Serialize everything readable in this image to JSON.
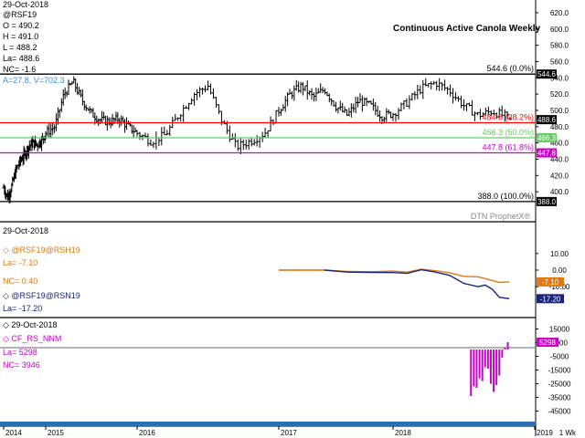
{
  "title": "Continuous Active Canola Weekly",
  "watermark": "DTN ProphetX®",
  "price_panel": {
    "date": "29-Oct-2018",
    "symbol": "@RSF19",
    "ohlc": [
      "O = 490.2",
      "H = 491.0",
      "L = 488.2",
      "La= 488.6",
      "NC= -1.6"
    ],
    "cursor_readout": "A=27.8, V=702.3",
    "y_ticks": [
      400,
      420,
      440,
      460,
      480,
      500,
      520,
      540,
      560,
      580,
      600,
      620
    ],
    "last_price_label": "488.6",
    "fib_levels": [
      {
        "price": 544.6,
        "label": "544.6 (0.0%)",
        "line_color": "#000000",
        "text_color": "#000000"
      },
      {
        "price": 484.8,
        "label": "484.8 (38.2%)",
        "line_color": "#ff0000",
        "text_color": "#ff0000"
      },
      {
        "price": 466.3,
        "label": "466.3 (50.0%)",
        "line_color": "#66cc66",
        "text_color": "#66cc66"
      },
      {
        "price": 447.8,
        "label": "447.8 (61.8%)",
        "line_color": "#cc00cc",
        "text_color": "#cc00cc"
      },
      {
        "price": 388.0,
        "label": "388.0 (100.0%)",
        "line_color": "#000000",
        "text_color": "#000000"
      }
    ],
    "axis_boxes": [
      {
        "price": 544.6,
        "text": "544.6",
        "fill": "#000000"
      },
      {
        "price": 488.6,
        "text": "488.6",
        "fill": "#000000"
      },
      {
        "price": 466.3,
        "text": "466.3",
        "fill": "#66cc66"
      },
      {
        "price": 447.8,
        "text": "447.8",
        "fill": "#cc00cc"
      },
      {
        "price": 388.0,
        "text": "388.0",
        "fill": "#000000"
      }
    ]
  },
  "spread_panel": {
    "date": "29-Oct-2018",
    "legend": [
      {
        "symbol": "@RSF19@RSH19",
        "color": "#e07a10"
      },
      {
        "symbol": "@RSF19@RSN19",
        "color": "#1a237e"
      }
    ],
    "readouts": [
      {
        "text": "La= -7.10",
        "color": "#e07a10"
      },
      {
        "text": "NC= 0.40",
        "color": "#e07a10"
      },
      {
        "text": "La= -17.20",
        "color": "#1a237e"
      }
    ],
    "y_ticks": [
      10.0,
      0.0,
      -10.0
    ],
    "axis_boxes": [
      {
        "value": -7.1,
        "text": "-7.10",
        "fill": "#e07a10"
      },
      {
        "value": -17.2,
        "text": "-17.20",
        "fill": "#1a237e"
      }
    ]
  },
  "cot_panel": {
    "date": "29-Oct-2018",
    "symbol": "CF_RS_NNM",
    "color": "#cc00cc",
    "readouts": [
      "La= 5298",
      "NC= 3946"
    ],
    "y_ticks": [
      15000,
      5000,
      -5000,
      -15000,
      -25000,
      -35000,
      -45000
    ],
    "axis_box": {
      "value": 5298,
      "text": "5298",
      "fill": "#cc00cc"
    }
  },
  "x_axis": {
    "labels": [
      "2014",
      "2015",
      "2016",
      "2017",
      "2018",
      "2019"
    ],
    "label_dates": [
      2014.0,
      2015.0,
      2016.0,
      2017.0,
      2018.0,
      2019.0
    ],
    "unit_label": "1 Wk"
  },
  "chart_data": [
    {
      "type": "candlestick",
      "title": "Continuous Active Canola Weekly",
      "series_name": "@RSF19",
      "ylim": [
        380,
        630
      ],
      "xlim": [
        2014.0,
        2019.3
      ],
      "weekly_close_estimates": [
        [
          2014.0,
          405
        ],
        [
          2014.1,
          393
        ],
        [
          2014.2,
          408
        ],
        [
          2014.3,
          428
        ],
        [
          2014.4,
          438
        ],
        [
          2014.5,
          446
        ],
        [
          2014.6,
          456
        ],
        [
          2014.7,
          460
        ],
        [
          2014.8,
          458
        ],
        [
          2014.9,
          463
        ],
        [
          2015.0,
          472
        ],
        [
          2015.1,
          480
        ],
        [
          2015.2,
          520
        ],
        [
          2015.3,
          535
        ],
        [
          2015.4,
          512
        ],
        [
          2015.5,
          496
        ],
        [
          2015.6,
          488
        ],
        [
          2015.7,
          486
        ],
        [
          2015.8,
          490
        ],
        [
          2015.9,
          480
        ],
        [
          2016.0,
          472
        ],
        [
          2016.1,
          462
        ],
        [
          2016.2,
          470
        ],
        [
          2016.3,
          496
        ],
        [
          2016.4,
          520
        ],
        [
          2016.5,
          530
        ],
        [
          2016.6,
          486
        ],
        [
          2016.7,
          455
        ],
        [
          2016.8,
          462
        ],
        [
          2016.9,
          472
        ],
        [
          2017.0,
          500
        ],
        [
          2017.1,
          520
        ],
        [
          2017.2,
          530
        ],
        [
          2017.3,
          516
        ],
        [
          2017.4,
          526
        ],
        [
          2017.5,
          505
        ],
        [
          2017.6,
          494
        ],
        [
          2017.7,
          512
        ],
        [
          2017.8,
          506
        ],
        [
          2017.9,
          493
        ],
        [
          2018.0,
          496
        ],
        [
          2018.1,
          510
        ],
        [
          2018.2,
          527
        ],
        [
          2018.3,
          534
        ],
        [
          2018.4,
          524
        ],
        [
          2018.5,
          506
        ],
        [
          2018.6,
          494
        ],
        [
          2018.7,
          499
        ],
        [
          2018.8,
          492
        ],
        [
          2018.82,
          488.6
        ]
      ],
      "last": {
        "open": 490.2,
        "high": 491.0,
        "low": 488.2,
        "close": 488.6,
        "net_change": -1.6
      }
    },
    {
      "type": "line",
      "series": [
        {
          "name": "@RSF19@RSH19",
          "x": [
            2017.0,
            2017.2,
            2017.4,
            2017.6,
            2017.8,
            2018.0,
            2018.1,
            2018.2,
            2018.3,
            2018.4,
            2018.5,
            2018.6,
            2018.7,
            2018.75,
            2018.82
          ],
          "y": [
            0.0,
            0.0,
            0.0,
            -0.8,
            -1.0,
            -0.6,
            -1.2,
            0.6,
            -0.4,
            -1.6,
            -3.8,
            -4.0,
            -6.2,
            -7.4,
            -7.1
          ]
        },
        {
          "name": "@RSF19@RSN19",
          "x": [
            2017.4,
            2017.6,
            2017.8,
            2018.0,
            2018.1,
            2018.2,
            2018.3,
            2018.4,
            2018.5,
            2018.6,
            2018.65,
            2018.7,
            2018.75,
            2018.82
          ],
          "y": [
            0.0,
            -1.2,
            -1.4,
            -1.5,
            -2.0,
            0.2,
            -1.2,
            -3.2,
            -8.0,
            -10.0,
            -9.0,
            -11.5,
            -16.4,
            -17.2
          ]
        }
      ]
    },
    {
      "type": "bar",
      "series": [
        {
          "name": "CF_RS_NNM",
          "x": [
            2018.55,
            2018.57,
            2018.59,
            2018.61,
            2018.63,
            2018.65,
            2018.67,
            2018.69,
            2018.71,
            2018.73,
            2018.75,
            2018.77,
            2018.79,
            2018.81
          ],
          "values": [
            -34000,
            -27000,
            -28000,
            -21000,
            -23000,
            -13000,
            -14000,
            -25000,
            -31000,
            -26000,
            -19000,
            -6000,
            1300,
            5298
          ]
        }
      ],
      "reference_value": 1352
    }
  ]
}
